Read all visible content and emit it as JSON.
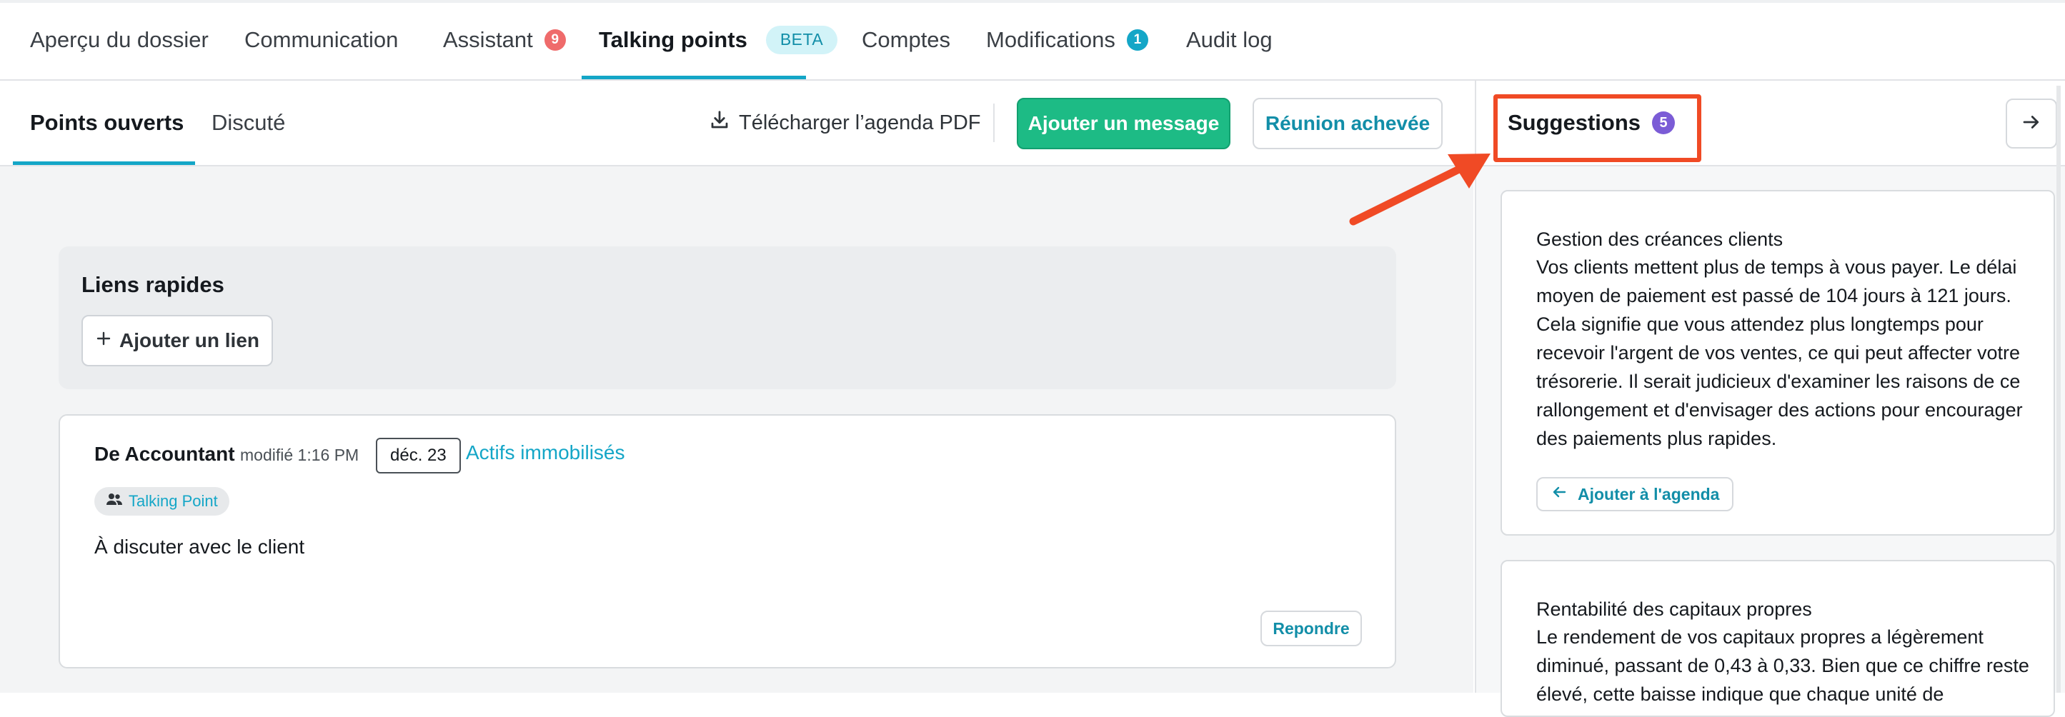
{
  "nav": {
    "tabs": [
      {
        "label": "Aperçu du dossier"
      },
      {
        "label": "Communication"
      },
      {
        "label": "Assistant",
        "badge": "9",
        "badge_color": "#ef6b6b"
      },
      {
        "label": "Talking points",
        "badge": "BETA",
        "active": true
      },
      {
        "label": "Comptes"
      },
      {
        "label": "Modifications",
        "badge": "1",
        "badge_color": "#14a6c7"
      },
      {
        "label": "Audit log"
      }
    ]
  },
  "subbar": {
    "tabs": [
      {
        "label": "Points ouverts",
        "active": true
      },
      {
        "label": "Discuté"
      }
    ],
    "download_label": "Télécharger l’agenda PDF",
    "add_message_label": "Ajouter un message",
    "meeting_done_label": "Réunion achevée"
  },
  "quicklinks": {
    "title": "Liens rapides",
    "add_link_label": "Ajouter un lien"
  },
  "card": {
    "author": "De Accountant",
    "modified": "modifié 1:16 PM",
    "date": "déc. 23",
    "category": "Actifs immobilisés",
    "chip": "Talking Point",
    "body": "À discuter avec le client",
    "reply_label": "Repondre"
  },
  "suggestions": {
    "title": "Suggestions",
    "count": "5",
    "items": [
      {
        "title": "Gestion des créances clients",
        "body": "Vos clients mettent plus de temps à vous payer. Le délai moyen de paiement est passé de 104 jours à 121 jours. Cela signifie que vous attendez plus longtemps pour recevoir l'argent de vos ventes, ce qui peut affecter votre trésorerie. Il serait judicieux d'examiner les raisons de ce rallongement et d'envisager des actions pour encourager des paiements plus rapides.",
        "action_label": "Ajouter à l'agenda"
      },
      {
        "title": "Rentabilité des capitaux propres",
        "body": "Le rendement de vos capitaux propres a légèrement diminué, passant de 0,43 à 0,33. Bien que ce chiffre reste élevé, cette baisse indique que chaque unité de"
      }
    ]
  },
  "colors": {
    "accent": "#14a6c7",
    "primary_green": "#1dbb85",
    "annotation_red": "#f04a25",
    "purple_badge": "#7b5cd6"
  }
}
